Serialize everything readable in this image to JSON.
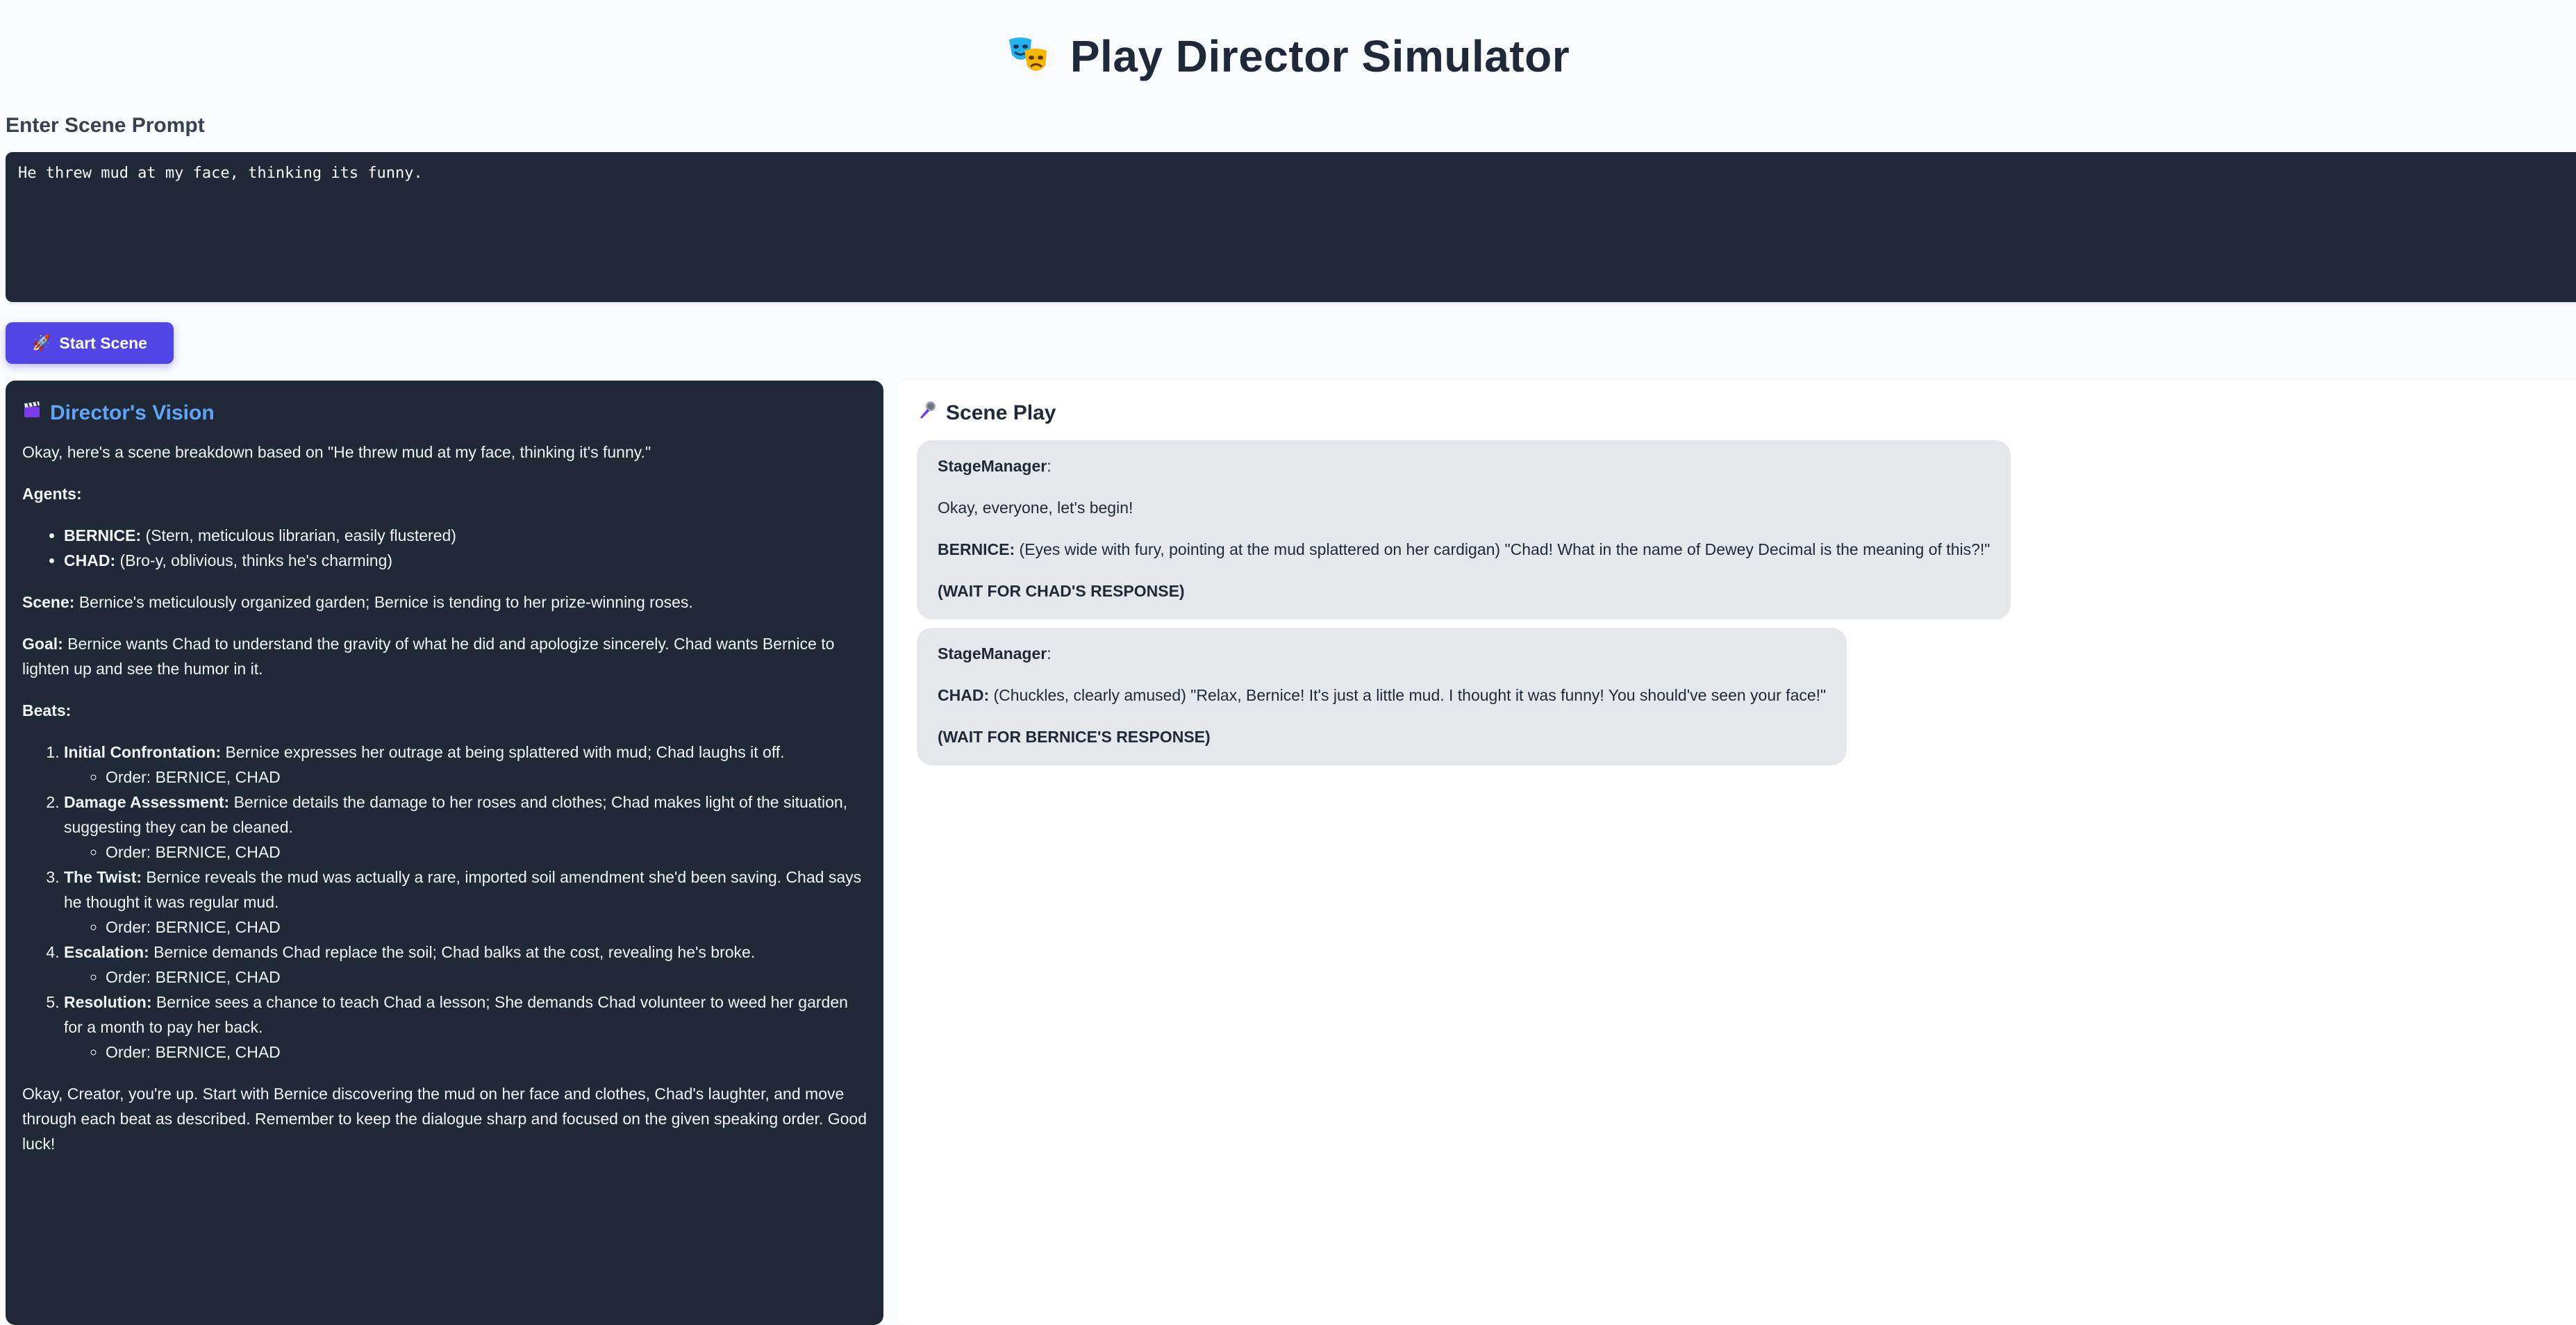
{
  "app": {
    "title": "Play Director Simulator",
    "icon": "theater-masks-icon"
  },
  "prompt": {
    "label": "Enter Scene Prompt",
    "value": "He threw mud at my face, thinking its funny."
  },
  "start_button": {
    "label": "Start Scene",
    "icon": "rocket-icon"
  },
  "director": {
    "title": "Director's Vision",
    "icon": "clapperboard-icon",
    "intro": "Okay, here's a scene breakdown based on \"He threw mud at my face, thinking it's funny.\"",
    "agents_heading": "Agents:",
    "agents": [
      {
        "name": "BERNICE:",
        "desc": " (Stern, meticulous librarian, easily flustered)"
      },
      {
        "name": "CHAD:",
        "desc": " (Bro-y, oblivious, thinks he's charming)"
      }
    ],
    "scene_label": "Scene:",
    "scene_text": " Bernice's meticulously organized garden; Bernice is tending to her prize-winning roses.",
    "goal_label": "Goal:",
    "goal_text": " Bernice wants Chad to understand the gravity of what he did and apologize sincerely. Chad wants Bernice to lighten up and see the humor in it.",
    "beats_heading": "Beats:",
    "beats": [
      {
        "label": "Initial Confrontation:",
        "text": " Bernice expresses her outrage at being splattered with mud; Chad laughs it off.",
        "order": "Order: BERNICE, CHAD"
      },
      {
        "label": "Damage Assessment:",
        "text": " Bernice details the damage to her roses and clothes; Chad makes light of the situation, suggesting they can be cleaned.",
        "order": "Order: BERNICE, CHAD"
      },
      {
        "label": "The Twist:",
        "text": " Bernice reveals the mud was actually a rare, imported soil amendment she'd been saving. Chad says he thought it was regular mud.",
        "order": "Order: BERNICE, CHAD"
      },
      {
        "label": "Escalation:",
        "text": " Bernice demands Chad replace the soil; Chad balks at the cost, revealing he's broke.",
        "order": "Order: BERNICE, CHAD"
      },
      {
        "label": "Resolution:",
        "text": " Bernice sees a chance to teach Chad a lesson; She demands Chad volunteer to weed her garden for a month to pay her back.",
        "order": "Order: BERNICE, CHAD"
      }
    ],
    "closing": "Okay, Creator, you're up. Start with Bernice discovering the mud on her face and clothes, Chad's laughter, and move through each beat as described. Remember to keep the dialogue sharp and focused on the given speaking order. Good luck!"
  },
  "scene_play": {
    "title": "Scene Play",
    "icon": "microphone-icon",
    "messages": [
      {
        "speaker": "StageManager",
        "intro": "Okay, everyone, let's begin!",
        "line_speaker": "BERNICE:",
        "line_text": " (Eyes wide with fury, pointing at the mud splattered on her cardigan) \"Chad! What in the name of Dewey Decimal is the meaning of this?!\"",
        "wait": "(WAIT FOR CHAD'S RESPONSE)"
      },
      {
        "speaker": "StageManager",
        "line_speaker": "CHAD:",
        "line_text": " (Chuckles, clearly amused) \"Relax, Bernice! It's just a little mud. I thought it was funny! You should've seen your face!\"",
        "wait": "(WAIT FOR BERNICE'S RESPONSE)"
      }
    ]
  },
  "colors": {
    "accent": "#4f46e5",
    "director_title": "#60a5fa",
    "dark_panel": "#1f2937",
    "bubble": "#e5e7eb"
  }
}
